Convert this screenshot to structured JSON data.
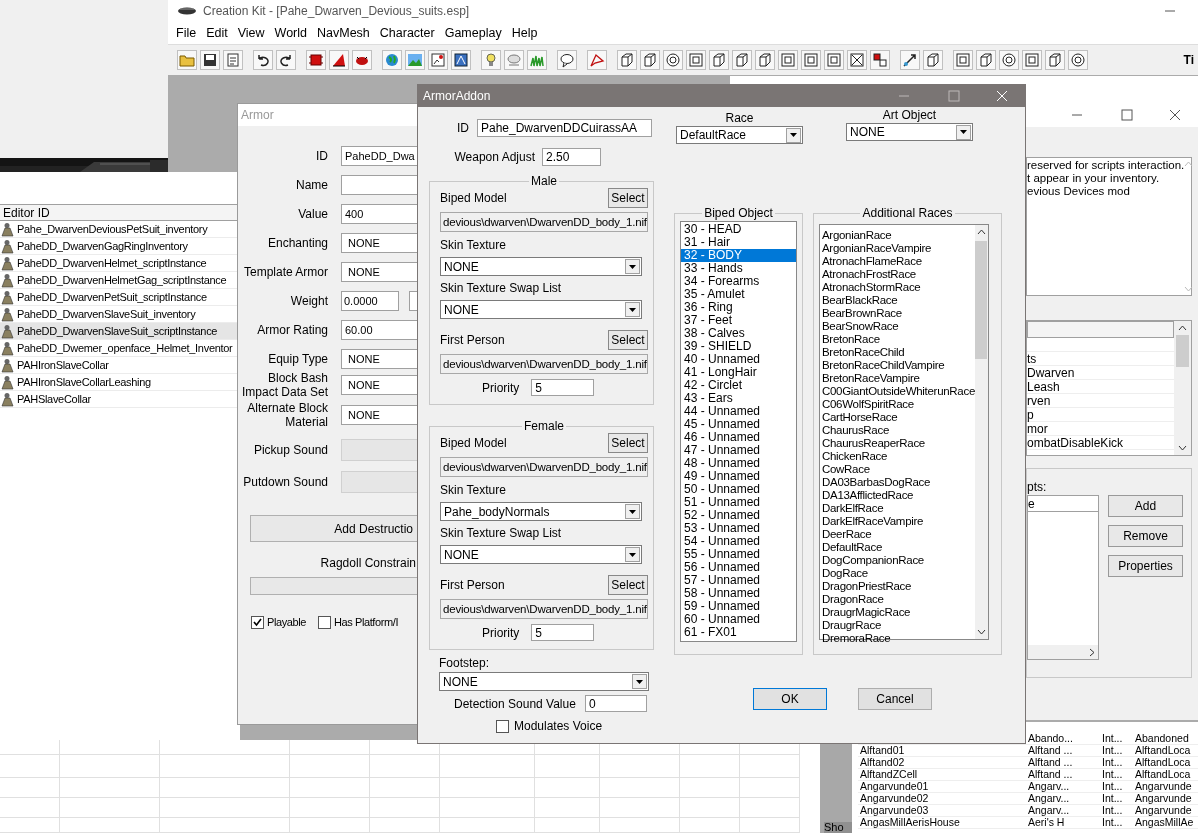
{
  "main_window": {
    "title": "Creation Kit - [Pahe_Dwarven_Devious_suits.esp]",
    "menu": [
      "File",
      "Edit",
      "View",
      "World",
      "NavMesh",
      "Character",
      "Gameplay",
      "Help"
    ],
    "edge_text": "Ti"
  },
  "object_window": {
    "column": "Editor ID",
    "rows": [
      {
        "editor_id": "Pahe_DwarvenDeviousPetSuit_inventory",
        "selected": false
      },
      {
        "editor_id": "PaheDD_DwarvenGagRingInventory",
        "selected": false
      },
      {
        "editor_id": "PaheDD_DwarvenHelmet_scriptInstance",
        "selected": false
      },
      {
        "editor_id": "PaheDD_DwarvenHelmetGag_scriptInstance",
        "selected": false
      },
      {
        "editor_id": "PaheDD_DwarvenPetSuit_scriptInstance",
        "selected": false
      },
      {
        "editor_id": "PaheDD_DwarvenSlaveSuit_inventory",
        "selected": false
      },
      {
        "editor_id": "PaheDD_DwarvenSlaveSuit_scriptInstance",
        "selected": true
      },
      {
        "editor_id": "PaheDD_Dwemer_openface_Helmet_Inventor",
        "selected": false
      },
      {
        "editor_id": "PAHIronSlaveCollar",
        "selected": false
      },
      {
        "editor_id": "PAHIronSlaveCollarLeashing",
        "selected": false
      },
      {
        "editor_id": "PAHSlaveCollar",
        "selected": false
      }
    ]
  },
  "armor_window": {
    "title": "Armor",
    "fields": [
      {
        "label": "ID",
        "value": "PaheDD_Dwa",
        "kind": "text"
      },
      {
        "label": "Name",
        "kind": "text"
      },
      {
        "label": "Value",
        "value": "400",
        "kind": "text"
      },
      {
        "label": "Enchanting",
        "value": "NONE",
        "kind": "select"
      },
      {
        "label": "Template Armor",
        "value": "NONE",
        "kind": "select"
      },
      {
        "label": "Weight",
        "value": "0.0000",
        "kind": "pair"
      },
      {
        "label": "Armor Rating",
        "value": "60.00",
        "kind": "text"
      },
      {
        "label": "Equip Type",
        "value": "NONE",
        "kind": "select"
      },
      {
        "label": "Block Bash\nImpact Data Set",
        "value": "NONE",
        "kind": "select"
      },
      {
        "label": "Alternate Block\nMaterial",
        "value": "NONE",
        "kind": "select"
      },
      {
        "label": "Pickup Sound",
        "kind": "disabled"
      },
      {
        "label": "Putdown Sound",
        "kind": "disabled"
      }
    ],
    "destruction_button": "Add Destructio",
    "ragdoll_label": "Ragdoll Constrain",
    "checkboxes": [
      {
        "label": "Playable",
        "checked": true
      },
      {
        "label": "Has Platform/I",
        "checked": false
      }
    ]
  },
  "armor_addon": {
    "title": "ArmorAddon",
    "id_label": "ID",
    "id": "Pahe_DwarvenDDCuirassAA",
    "weapon_adjust_label": "Weapon Adjust",
    "weapon_adjust": "2.50",
    "genders": [
      {
        "legend": "Male",
        "biped_model_label": "Biped Model",
        "biped_select": "Select",
        "biped_model": "devious\\dwarven\\DwarvenDD_body_1.nif",
        "skin_texture_label": "Skin Texture",
        "skin_texture": "NONE",
        "swap_list_label": "Skin Texture Swap List",
        "swap_list": "NONE",
        "first_person_label": "First Person",
        "first_person_select": "Select",
        "first_person": "devious\\dwarven\\DwarvenDD_body_1.nif",
        "priority_label": "Priority",
        "priority": "5"
      },
      {
        "legend": "Female",
        "biped_model_label": "Biped Model",
        "biped_select": "Select",
        "biped_model": "devious\\dwarven\\DwarvenDD_body_1.nif",
        "skin_texture_label": "Skin Texture",
        "skin_texture": "Pahe_bodyNormals",
        "swap_list_label": "Skin Texture Swap List",
        "swap_list": "NONE",
        "first_person_label": "First Person",
        "first_person_select": "Select",
        "first_person": "devious\\dwarven\\DwarvenDD_body_1.nif",
        "priority_label": "Priority",
        "priority": "5"
      }
    ],
    "footstep_label": "Footstep:",
    "footstep": "NONE",
    "detection_label": "Detection Sound Value",
    "detection": "0",
    "modulates_voice": {
      "label": "Modulates Voice",
      "checked": false
    },
    "race_label": "Race",
    "race": "DefaultRace",
    "art_object_label": "Art Object",
    "art_object": "NONE",
    "biped_object": {
      "legend": "Biped Object",
      "items": [
        {
          "label": "30 - HEAD",
          "selected": false
        },
        {
          "label": "31 - Hair",
          "selected": false
        },
        {
          "label": "32 - BODY",
          "selected": true
        },
        {
          "label": "33 - Hands",
          "selected": false
        },
        {
          "label": "34 - Forearms",
          "selected": false
        },
        {
          "label": "35 - Amulet",
          "selected": false
        },
        {
          "label": "36 - Ring",
          "selected": false
        },
        {
          "label": "37 - Feet",
          "selected": false
        },
        {
          "label": "38 - Calves",
          "selected": false
        },
        {
          "label": "39 - SHIELD",
          "selected": false
        },
        {
          "label": "40 - Unnamed",
          "selected": false
        },
        {
          "label": "41 - LongHair",
          "selected": false
        },
        {
          "label": "42 - Circlet",
          "selected": false
        },
        {
          "label": "43 - Ears",
          "selected": false
        },
        {
          "label": "44 - Unnamed",
          "selected": false
        },
        {
          "label": "45 - Unnamed",
          "selected": false
        },
        {
          "label": "46 - Unnamed",
          "selected": false
        },
        {
          "label": "47 - Unnamed",
          "selected": false
        },
        {
          "label": "48 - Unnamed",
          "selected": false
        },
        {
          "label": "49 - Unnamed",
          "selected": false
        },
        {
          "label": "50 - Unnamed",
          "selected": false
        },
        {
          "label": "51 - Unnamed",
          "selected": false
        },
        {
          "label": "52 - Unnamed",
          "selected": false
        },
        {
          "label": "53 - Unnamed",
          "selected": false
        },
        {
          "label": "54 - Unnamed",
          "selected": false
        },
        {
          "label": "55 - Unnamed",
          "selected": false
        },
        {
          "label": "56 - Unnamed",
          "selected": false
        },
        {
          "label": "57 - Unnamed",
          "selected": false
        },
        {
          "label": "58 - Unnamed",
          "selected": false
        },
        {
          "label": "59 - Unnamed",
          "selected": false
        },
        {
          "label": "60 - Unnamed",
          "selected": false
        },
        {
          "label": "61 - FX01",
          "selected": false
        }
      ]
    },
    "additional_races": {
      "legend": "Additional Races",
      "items": [
        "ArgonianRace",
        "ArgonianRaceVampire",
        "AtronachFlameRace",
        "AtronachFrostRace",
        "AtronachStormRace",
        "BearBlackRace",
        "BearBrownRace",
        "BearSnowRace",
        "BretonRace",
        "BretonRaceChild",
        "BretonRaceChildVampire",
        "BretonRaceVampire",
        "C00GiantOutsideWhiterunRace",
        "C06WolfSpiritRace",
        "CartHorseRace",
        "ChaurusRace",
        "ChaurusReaperRace",
        "ChickenRace",
        "CowRace",
        "DA03BarbasDogRace",
        "DA13AfflictedRace",
        "DarkElfRace",
        "DarkElfRaceVampire",
        "DeerRace",
        "DefaultRace",
        "DogCompanionRace",
        "DogRace",
        "DragonPriestRace",
        "DragonRace",
        "DraugrMagicRace",
        "DraugrRace",
        "DremoraRace"
      ]
    },
    "buttons": [
      "OK",
      "Cancel"
    ]
  },
  "background_window": {
    "description": [
      "reserved for scripts interaction.",
      "t appear in your inventory.",
      "evious Devices mod"
    ],
    "rows": [
      "ts",
      "Dwarven",
      "Leash",
      "rven",
      "p",
      "mor",
      "ombatDisableKick"
    ],
    "scripts_label": "pts:",
    "scripts_column": "e",
    "buttons": [
      "Add",
      "Remove",
      "Properties"
    ]
  },
  "cell_window": {
    "side_label": "Sho",
    "rows": [
      {
        "location": "Abando...",
        "type": "Int...",
        "location_id": "Abandoned"
      },
      {
        "name": "Alftand01",
        "location": "Alftand ...",
        "type": "Int...",
        "location_id": "AlftandLoca"
      },
      {
        "name": "Alftand02",
        "location": "Alftand ...",
        "type": "Int...",
        "location_id": "AlftandLoca"
      },
      {
        "name": "AlftandZCell",
        "location": "Alftand ...",
        "type": "Int...",
        "location_id": "AlftandLoca"
      },
      {
        "name": "Angarvunde01",
        "location": "Angarv...",
        "type": "Int...",
        "location_id": "Angarvunde"
      },
      {
        "name": "Angarvunde02",
        "location": "Angarv...",
        "type": "Int...",
        "location_id": "Angarvunde"
      },
      {
        "name": "Angarvunde03",
        "location": "Angarv...",
        "type": "Int...",
        "location_id": "Angarvunde"
      },
      {
        "name": "AngasMillAerisHouse",
        "location": "Aeri's H",
        "type": "Int...",
        "location_id": "AngasMillAe"
      }
    ]
  }
}
